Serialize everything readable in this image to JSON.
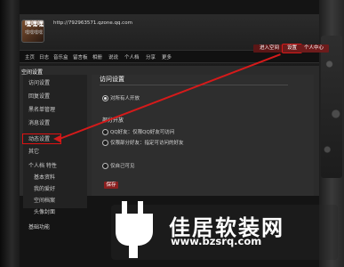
{
  "header": {
    "user_name": "嘿嘿嘿",
    "space_url": "http://792963571.qzone.qq.com",
    "space_subtitle": "嘿嘿嘿嘿",
    "enter_space_label": "进入空间",
    "settings_label": "设置",
    "personal_center_label": "个人中心",
    "nav_items": [
      "主页",
      "日志",
      "音乐盒",
      "留言板",
      "相册",
      "说说",
      "个人档",
      "分享",
      "更多"
    ]
  },
  "main": {
    "section_title": "空间设置",
    "sidebar_items": [
      "访问设置",
      "回复设置",
      "黑名单管理",
      "消息设置",
      "动态设置",
      "其它",
      "个人档 特性",
      "基本资料",
      "我的爱好",
      "空间档案",
      "头像封面",
      "基础功能"
    ],
    "content_title": "访问设置",
    "access_option": "对所有人开放",
    "sub_title": "部分开放",
    "options": [
      "QQ好友：仅限QQ好友可访问",
      "仅限部分好友：指定可访问的好友",
      "仅自己可见"
    ],
    "save_label": "保存"
  },
  "watermark": {
    "title": "佳居软装网",
    "url": "www.bzsrq.com"
  },
  "colors": {
    "accent_red": "#d51a1a",
    "header_bg": "#1b1b1b",
    "panel_bg": "#2b2b2b"
  }
}
